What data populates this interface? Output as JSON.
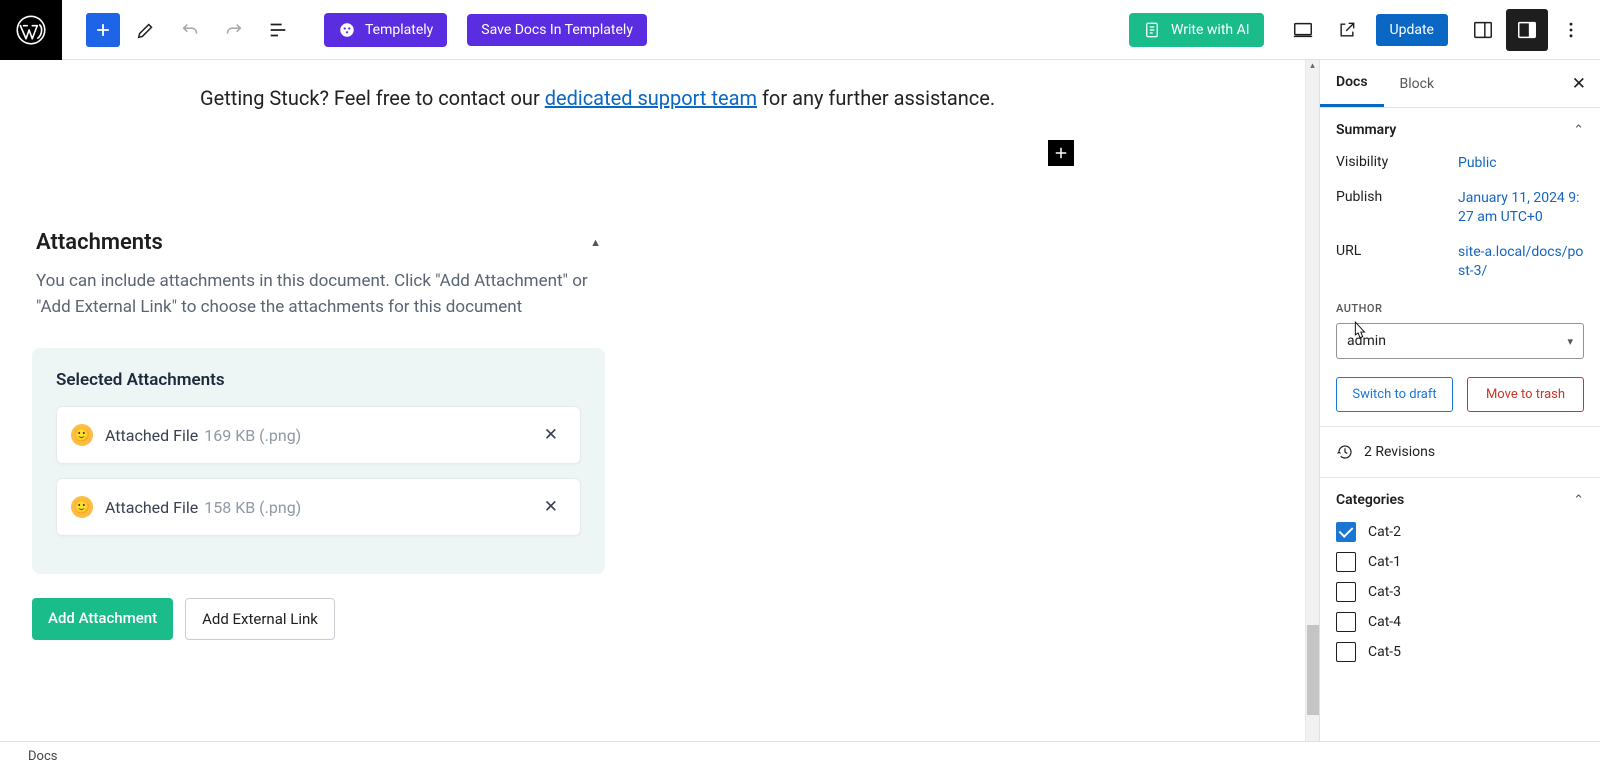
{
  "topbar": {
    "templately_label": "Templately",
    "save_docs_label": "Save Docs In Templately",
    "write_ai_label": "Write with AI",
    "update_label": "Update"
  },
  "editor": {
    "help_prefix": "Getting Stuck? Feel free to contact our ",
    "help_link_text": "dedicated support team",
    "help_suffix": " for any further assistance."
  },
  "attachments": {
    "title": "Attachments",
    "description": "You can include attachments in this document. Click \"Add Attachment\" or \"Add External Link\" to choose the attachments for this document",
    "selected_title": "Selected Attachments",
    "files": [
      {
        "name": "Attached File",
        "size": "169 KB (.png)"
      },
      {
        "name": "Attached File",
        "size": "158 KB (.png)"
      }
    ],
    "add_attachment_label": "Add Attachment",
    "add_external_label": "Add External Link"
  },
  "sidebar": {
    "tabs": {
      "docs": "Docs",
      "block": "Block"
    },
    "summary": {
      "title": "Summary",
      "visibility_label": "Visibility",
      "visibility_value": "Public",
      "publish_label": "Publish",
      "publish_value": "January 11, 2024 9:27 am UTC+0",
      "url_label": "URL",
      "url_value": "site-a.local/docs/post-3/",
      "author_label": "AUTHOR",
      "author_value": "admin",
      "switch_draft": "Switch to draft",
      "move_trash": "Move to trash"
    },
    "revisions": "2 Revisions",
    "categories": {
      "title": "Categories",
      "items": [
        {
          "label": "Cat-2",
          "checked": true
        },
        {
          "label": "Cat-1",
          "checked": false
        },
        {
          "label": "Cat-3",
          "checked": false
        },
        {
          "label": "Cat-4",
          "checked": false
        },
        {
          "label": "Cat-5",
          "checked": false
        }
      ]
    }
  },
  "footer": {
    "breadcrumb": "Docs"
  }
}
